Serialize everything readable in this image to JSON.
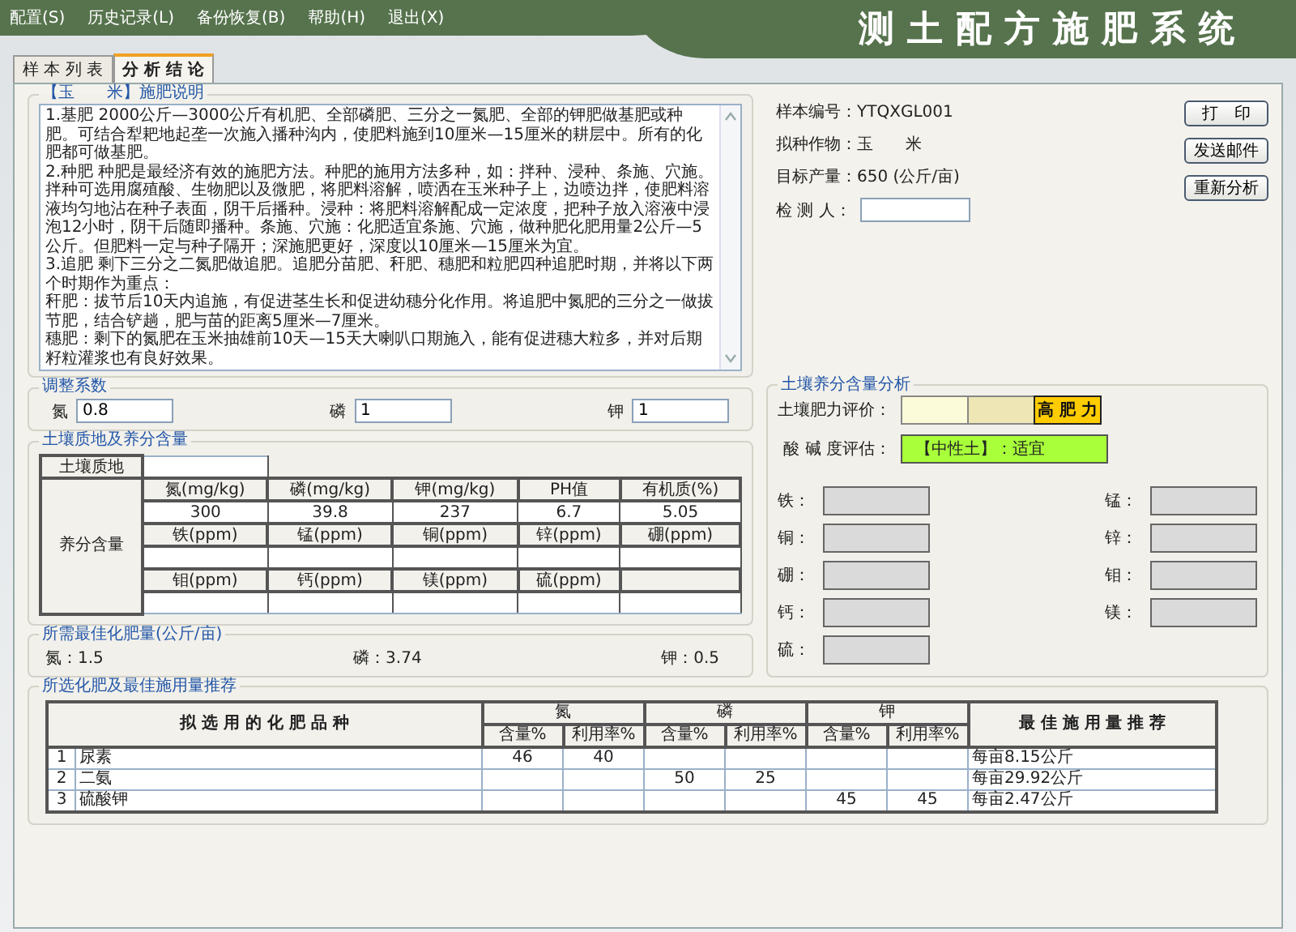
{
  "menu": [
    {
      "label": "配置(S)"
    },
    {
      "label": "历史记录(L)"
    },
    {
      "label": "备份恢复(B)"
    },
    {
      "label": "帮助(H)"
    },
    {
      "label": "退出(X)"
    }
  ],
  "app_title": "测土配方施肥系统",
  "tabs": [
    {
      "label": "样 本 列 表",
      "selected": false
    },
    {
      "label": "分 析 结 论",
      "selected": true
    }
  ],
  "description": {
    "legend": "【玉　　米】施肥说明",
    "paragraphs": [
      "1.基肥 2000公斤—3000公斤有机肥、全部磷肥、三分之一氮肥、全部的钾肥做基肥或种肥。可结合犁耙地起垄一次施入播种沟内，使肥料施到10厘米—15厘米的耕层中。所有的化肥都可做基肥。",
      "2.种肥 种肥是最经济有效的施肥方法。种肥的施用方法多种，如：拌种、浸种、条施、穴施。拌种可选用腐殖酸、生物肥以及微肥，将肥料溶解，喷洒在玉米种子上，边喷边拌，使肥料溶液均匀地沾在种子表面，阴干后播种。浸种：将肥料溶解配成一定浓度，把种子放入溶液中浸泡12小时，阴干后随即播种。条施、穴施：化肥适宜条施、穴施，做种肥化肥用量2公斤—5公斤。但肥料一定与种子隔开；深施肥更好，深度以10厘米—15厘米为宜。",
      "3.追肥 剩下三分之二氮肥做追肥。追肥分苗肥、秆肥、穗肥和粒肥四种追肥时期，并将以下两个时期作为重点：",
      "秆肥：拔节后10天内追施，有促进茎生长和促进幼穗分化作用。将追肥中氮肥的三分之一做拔节肥，结合铲趟，肥与苗的距离5厘米—7厘米。",
      "穗肥：剩下的氮肥在玉米抽雄前10天—15天大喇叭口期施入，能有促进穗大粒多，并对后期籽粒灌浆也有良好效果。"
    ]
  },
  "adjustment": {
    "legend": "调整系数",
    "fields": [
      {
        "label": "氮",
        "value": "0.8"
      },
      {
        "label": "磷",
        "value": "1"
      },
      {
        "label": "钾",
        "value": "1"
      }
    ]
  },
  "soil_table": {
    "legend": "土壤质地及养分含量",
    "texture_label": "土壤质地",
    "nutrient_label": "养分含量",
    "groups": [
      {
        "headers": [
          "氮(mg/kg)",
          "磷(mg/kg)",
          "钾(mg/kg)",
          "PH值",
          "有机质(%)"
        ],
        "values": [
          "300",
          "39.8",
          "237",
          "6.7",
          "5.05"
        ]
      },
      {
        "headers": [
          "铁(ppm)",
          "锰(ppm)",
          "铜(ppm)",
          "锌(ppm)",
          "硼(ppm)"
        ]
      },
      {
        "headers": [
          "钼(ppm)",
          "钙(ppm)",
          "镁(ppm)",
          "硫(ppm)"
        ]
      }
    ]
  },
  "required": {
    "legend": "所需最佳化肥量(公斤/亩)",
    "items": [
      {
        "label": "氮：",
        "value": "1.5"
      },
      {
        "label": "磷：",
        "value": "3.74"
      },
      {
        "label": "钾：",
        "value": "0.5"
      }
    ]
  },
  "sample_info": [
    {
      "label": "样本编号：",
      "value": "YTQXGL001"
    },
    {
      "label": "拟种作物：",
      "value": "玉　　米"
    },
    {
      "label": "目标产量：",
      "value": "650 (公斤/亩)"
    }
  ],
  "inspector": {
    "label": "检 测 人："
  },
  "buttons": [
    {
      "label": "打　印"
    },
    {
      "label": "发送邮件"
    },
    {
      "label": "重新分析"
    }
  ],
  "analysis": {
    "legend": "土壤养分含量分析",
    "fertility_label": "土壤肥力评价：",
    "fertility_levels": [
      {
        "color": "#fcfbd9",
        "selected": false
      },
      {
        "color": "#eee6b4",
        "selected": false
      },
      {
        "color": "#ffcc00",
        "label": "高 肥 力",
        "selected": true
      }
    ],
    "ph_label": "酸 碱 度评估：",
    "ph": {
      "text": "【中性土】：适宜",
      "color": "#a8ff3a"
    },
    "elements": [
      {
        "label": "铁："
      },
      {
        "label": "锰："
      },
      {
        "label": "铜："
      },
      {
        "label": "锌："
      },
      {
        "label": "硼："
      },
      {
        "label": "钼："
      },
      {
        "label": "钙："
      },
      {
        "label": "镁："
      },
      {
        "label": "硫："
      }
    ]
  },
  "fertilizers": {
    "legend": "所选化肥及最佳施用量推荐",
    "name_header": "拟 选 用 的 化 肥 品 种",
    "groups": [
      {
        "label": "氮",
        "sub": [
          "含量%",
          "利用率%"
        ]
      },
      {
        "label": "磷",
        "sub": [
          "含量%",
          "利用率%"
        ]
      },
      {
        "label": "钾",
        "sub": [
          "含量%",
          "利用率%"
        ]
      }
    ],
    "result_header": "最 佳 施 用 量 推 荐",
    "rows": [
      {
        "no": "1",
        "name": "尿素",
        "nitrogen": {
          "content": "46",
          "utilization": "40"
        },
        "result": "每亩8.15公斤"
      },
      {
        "no": "2",
        "name": "二氨",
        "phosphorus": {
          "content": "50",
          "utilization": "25"
        },
        "result": "每亩29.92公斤"
      },
      {
        "no": "3",
        "name": "硫酸钾",
        "potassium": {
          "content": "45",
          "utilization": "45"
        },
        "result": "每亩2.47公斤"
      }
    ]
  }
}
